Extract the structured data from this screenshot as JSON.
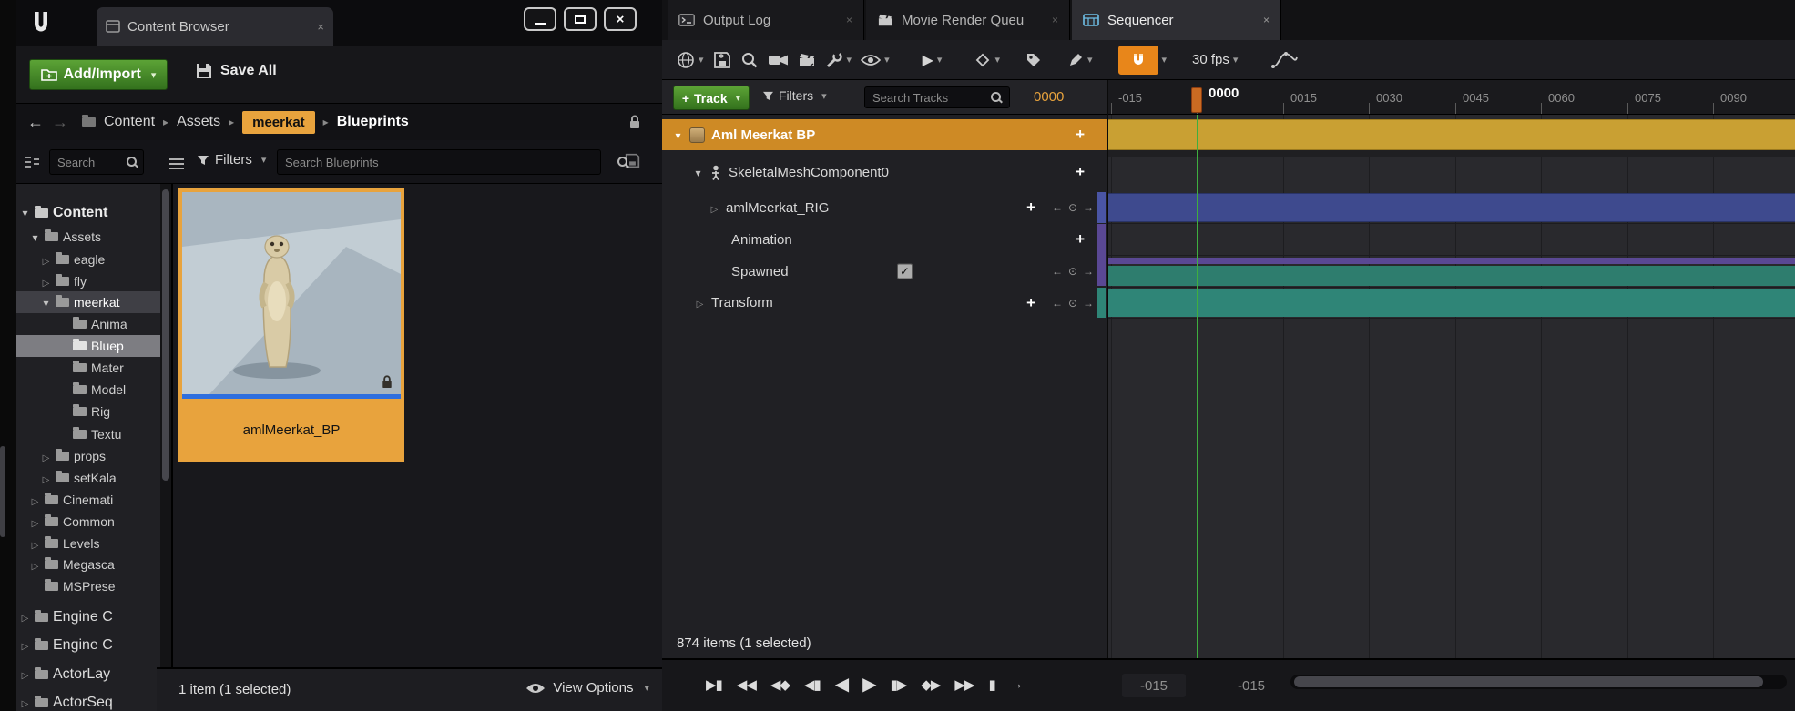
{
  "colors": {
    "accent_orange": "#E8A33D",
    "accent_green": "#56A030",
    "selected_track_orange": "#CE8A25",
    "timeline_gold": "#C9A033",
    "timeline_blue": "#3E4A8E",
    "timeline_purple": "#5A4894",
    "timeline_teal": "#2E8577",
    "playhead_green": "#3FAE3F",
    "magnet_orange": "#E8861A",
    "blueprint_blue": "#2F6FDE"
  },
  "content_browser": {
    "tab": {
      "label": "Content Browser"
    },
    "toolbar": {
      "add_import_label": "Add/Import",
      "save_all_label": "Save All"
    },
    "breadcrumb": {
      "items": [
        "Content",
        "Assets",
        "meerkat",
        "Blueprints"
      ]
    },
    "filter_bar": {
      "search_placeholder": "Search",
      "filters_label": "Filters",
      "search_blueprints_placeholder": "Search Blueprints"
    },
    "tree": {
      "items": [
        {
          "label": "Content"
        },
        {
          "label": "Assets"
        },
        {
          "label": "eagle"
        },
        {
          "label": "fly"
        },
        {
          "label": "meerkat"
        },
        {
          "label": "Anima"
        },
        {
          "label": "Bluep"
        },
        {
          "label": "Mater"
        },
        {
          "label": "Model"
        },
        {
          "label": "Rig"
        },
        {
          "label": "Textu"
        },
        {
          "label": "props"
        },
        {
          "label": "setKala"
        },
        {
          "label": "Cinemati"
        },
        {
          "label": "Common"
        },
        {
          "label": "Levels"
        },
        {
          "label": "Megasca"
        },
        {
          "label": "MSPrese"
        },
        {
          "label": "Engine C"
        },
        {
          "label": "Engine C"
        },
        {
          "label": "ActorLay"
        },
        {
          "label": "ActorSeq"
        }
      ]
    },
    "asset": {
      "label": "amlMeerkat_BP"
    },
    "status": {
      "items_label": "1 item (1 selected)",
      "view_options_label": "View Options"
    }
  },
  "sequencer": {
    "tabs": [
      {
        "label": "Output Log"
      },
      {
        "label": "Movie Render Queu"
      },
      {
        "label": "Sequencer"
      }
    ],
    "toolbar": {
      "fps_label": "30 fps"
    },
    "track_bar": {
      "track_label": "Track",
      "filters_label": "Filters",
      "search_placeholder": "Search Tracks",
      "current_frame": "0000"
    },
    "tracks": [
      {
        "label": "Aml Meerkat BP"
      },
      {
        "label": "SkeletalMeshComponent0"
      },
      {
        "label": "amlMeerkat_RIG"
      },
      {
        "label": "Animation"
      },
      {
        "label": "Spawned"
      },
      {
        "label": "Transform"
      }
    ],
    "ruler": {
      "labels": [
        "-015",
        "0000",
        "0015",
        "0030",
        "0045",
        "0060",
        "0075",
        "0090"
      ],
      "playhead_label": "0000"
    },
    "status": {
      "items_label": "874 items (1 selected)"
    },
    "range": {
      "start": "-015",
      "end": "-015"
    }
  },
  "icons": {
    "close": "×",
    "caret_down": "▾",
    "crumb_sep": "▸",
    "plus": "+",
    "check": "✓",
    "back": "←",
    "forward": "→",
    "nav_prev": "←",
    "nav_add": "⊙",
    "nav_next": "→",
    "playback": [
      "▶▮",
      "◀◀",
      "◀◆",
      "◀▮",
      "◀",
      "▶",
      "▮▶",
      "◆▶",
      "▶▶",
      "▮",
      "→"
    ]
  }
}
